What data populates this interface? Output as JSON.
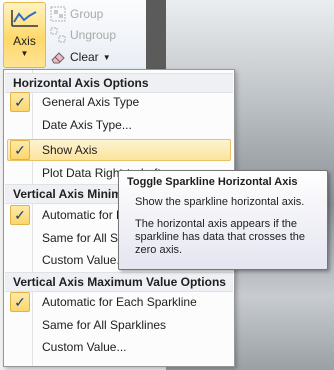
{
  "ribbon": {
    "axis_label": "Axis",
    "group_label": "Group",
    "ungroup_label": "Ungroup",
    "clear_label": "Clear"
  },
  "menu": {
    "horizontal_header": "Horizontal Axis Options",
    "horizontal_items": [
      {
        "label": "General Axis Type",
        "checked": true
      },
      {
        "label": "Date Axis Type...",
        "checked": false
      },
      {
        "label": "Show Axis",
        "checked": true
      },
      {
        "label": "Plot Data Right-to-Left",
        "checked": false
      }
    ],
    "vmin_header": "Vertical Axis Minimum Value Options",
    "vmin_items": [
      {
        "label": "Automatic for Each Sparkline",
        "checked": true
      },
      {
        "label": "Same for All Sparklines",
        "checked": false
      },
      {
        "label": "Custom Value...",
        "checked": false
      }
    ],
    "vmax_header": "Vertical Axis Maximum Value Options",
    "vmax_items": [
      {
        "label": "Automatic for Each Sparkline",
        "checked": true
      },
      {
        "label": "Same for All Sparklines",
        "checked": false
      },
      {
        "label": "Custom Value...",
        "checked": false
      }
    ]
  },
  "tooltip": {
    "title": "Toggle Sparkline Horizontal Axis",
    "line1": "Show the sparkline horizontal axis.",
    "line2": "The horizontal axis appears if the sparkline has data that crosses the zero axis."
  },
  "check_glyph": "✓"
}
